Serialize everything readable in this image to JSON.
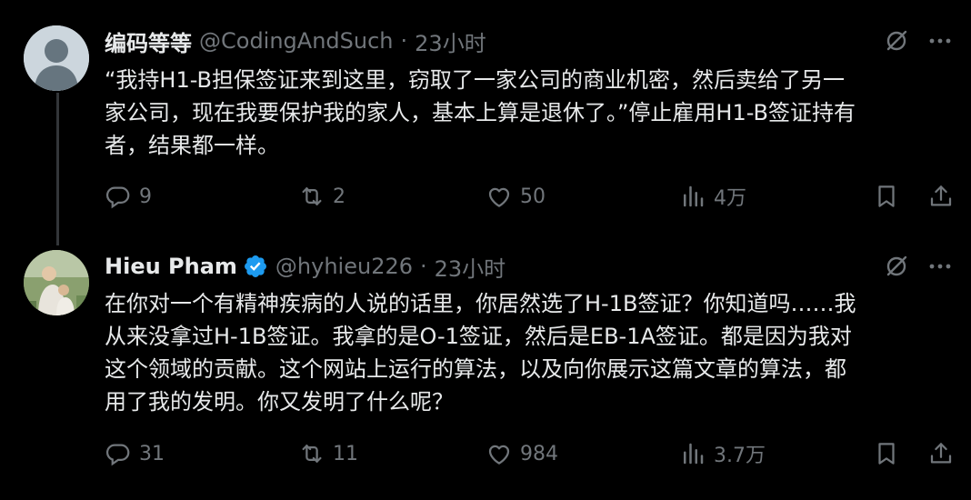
{
  "tweets": [
    {
      "author": {
        "display_name": "编码等等",
        "handle": "@CodingAndSuch",
        "verified": false,
        "avatar": "default-avatar"
      },
      "time": "23小时",
      "separator": "·",
      "text": "“我持H1-B担保签证来到这里，窃取了一家公司的商业机密，然后卖给了另一\n家公司，现在我要保护我的家人，基本上算是退休了。”停止雇用H1-B签证持有\n者，结果都一样。",
      "stats": {
        "replies": "9",
        "retweets": "2",
        "likes": "50",
        "views": "4万"
      }
    },
    {
      "author": {
        "display_name": "Hieu Pham",
        "handle": "@hyhieu226",
        "verified": true,
        "avatar": "photo-avatar"
      },
      "time": "23小时",
      "separator": "·",
      "text": "在你对一个有精神疾病的人说的话里，你居然选了H-1B签证？你知道吗……我\n从来没拿过H-1B签证。我拿的是O-1签证，然后是EB-1A签证。都是因为我对\n这个领域的贡献。这个网站上运行的算法，以及向你展示这篇文章的算法，都\n用了我的发明。你又发明了什么呢？",
      "stats": {
        "replies": "31",
        "retweets": "11",
        "likes": "984",
        "views": "3.7万"
      }
    }
  ],
  "colors": {
    "background": "#000000",
    "text": "#e7e9ea",
    "muted": "#71767b",
    "verified": "#1d9bf0",
    "thread_line": "#333639"
  },
  "icons": [
    "grok-icon",
    "more-icon",
    "reply-icon",
    "retweet-icon",
    "like-icon",
    "views-icon",
    "bookmark-icon",
    "share-icon",
    "verified-badge-icon"
  ]
}
